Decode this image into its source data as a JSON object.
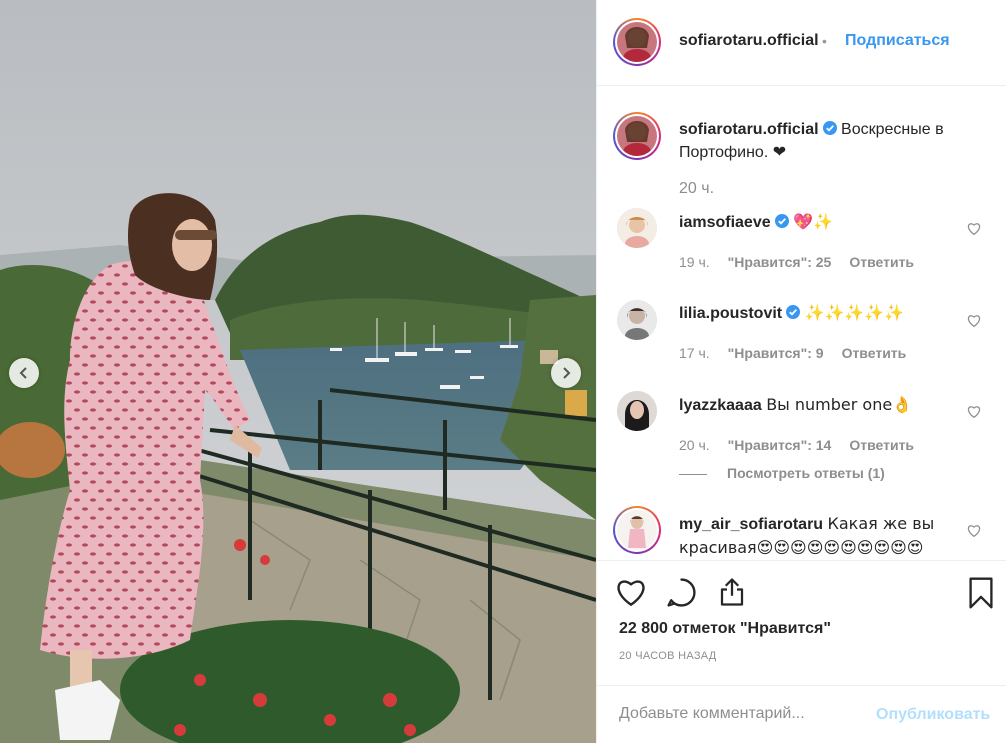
{
  "post": {
    "username": "sofiarotaru.official",
    "follow_label": "Подписаться",
    "header_separator": "•",
    "caption": "Воскресные в Портофино. ❤",
    "caption_time": "20 ч."
  },
  "comments": [
    {
      "username": "iamsofiaeve",
      "verified": true,
      "text": "💖✨",
      "time": "19 ч.",
      "likes": "\"Нравится\": 25",
      "reply": "Ответить"
    },
    {
      "username": "lilia.poustovit",
      "verified": true,
      "text": "✨✨✨✨✨",
      "time": "17 ч.",
      "likes": "\"Нравится\": 9",
      "reply": "Ответить"
    },
    {
      "username": "lyazzkaaaa",
      "verified": false,
      "text": "Вы number one👌",
      "time": "20 ч.",
      "likes": "\"Нравится\": 14",
      "reply": "Ответить",
      "view_replies": "Посмотреть ответы (1)"
    },
    {
      "username": "my_air_sofiarotaru",
      "verified": false,
      "text": "Какая же вы красивая😍😍😍😍😍😍😍😍😍😍"
    }
  ],
  "likes_count": "22 800 отметок \"Нравится\"",
  "time_ago": "20 ЧАСОВ НАЗАД",
  "comment_input": {
    "placeholder": "Добавьте комментарий...",
    "value": ""
  },
  "publish_label": "Опубликовать",
  "colors": {
    "link": "#3897f0",
    "publish_disabled": "#b2dffc",
    "verified": "#3897f0",
    "heart": "#c4161c",
    "muted": "#8e8e8e"
  },
  "icons": [
    "chevron-left-icon",
    "chevron-right-icon",
    "heart-icon",
    "comment-icon",
    "share-icon",
    "bookmark-icon",
    "verified-badge-icon"
  ]
}
